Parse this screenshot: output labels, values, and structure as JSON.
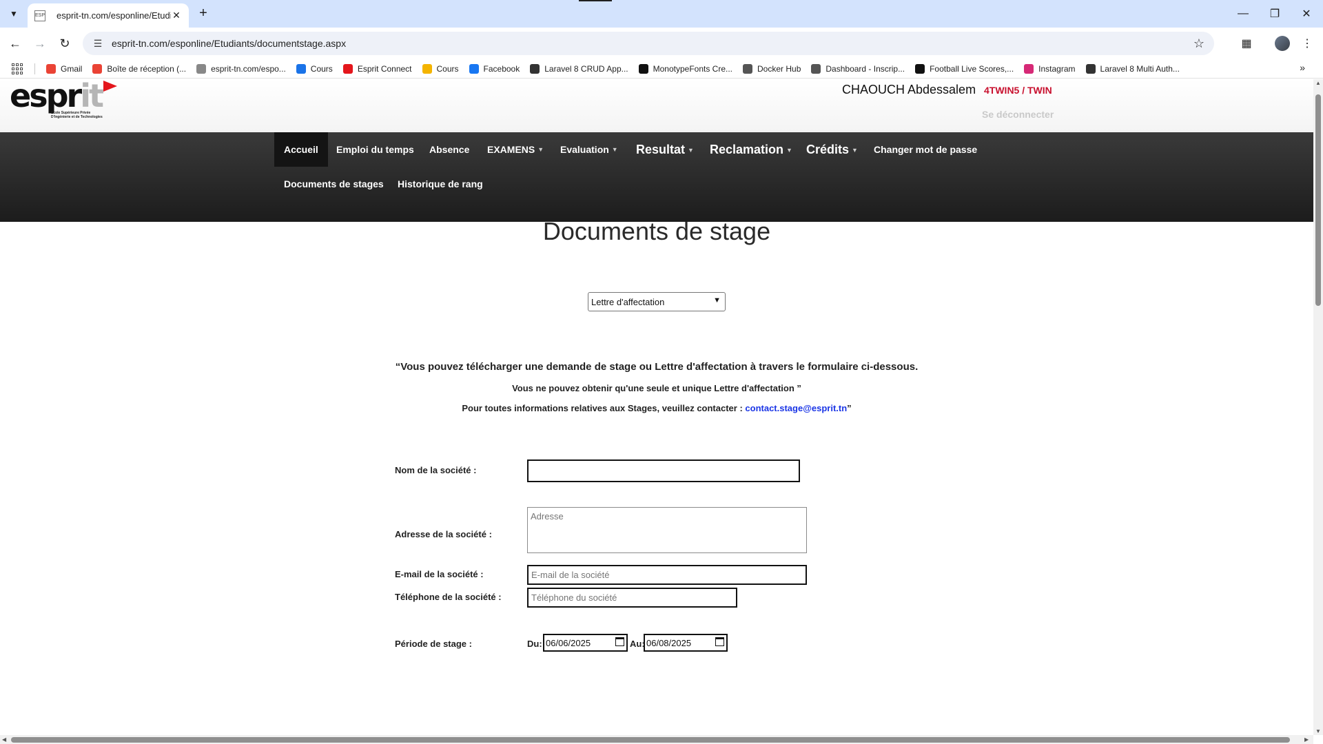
{
  "browser": {
    "tab_title": "esprit-tn.com/esponline/Etudia",
    "tab_favicon": "ESP",
    "url": "esprit-tn.com/esponline/Etudiants/documentstage.aspx",
    "bookmarks": [
      {
        "label": "Gmail",
        "icon": "gmail-icon",
        "color": "#ea4335"
      },
      {
        "label": "Boîte de réception (...",
        "icon": "gmail-icon",
        "color": "#ea4335"
      },
      {
        "label": "esprit-tn.com/espo...",
        "icon": "esprit-icon",
        "color": "#888888"
      },
      {
        "label": "Cours",
        "icon": "drive-icon",
        "color": "#1a73e8"
      },
      {
        "label": "Esprit Connect",
        "icon": "esprit-flag-icon",
        "color": "#e4161c"
      },
      {
        "label": "Cours",
        "icon": "classroom-icon",
        "color": "#f4b400"
      },
      {
        "label": "Facebook",
        "icon": "facebook-icon",
        "color": "#1877f2"
      },
      {
        "label": "Laravel 8 CRUD App...",
        "icon": "web-icon",
        "color": "#333333"
      },
      {
        "label": "MonotypeFonts Cre...",
        "icon": "monotype-icon",
        "color": "#111111"
      },
      {
        "label": "Docker Hub",
        "icon": "docker-icon",
        "color": "#555555"
      },
      {
        "label": "Dashboard - Inscrip...",
        "icon": "globe-icon",
        "color": "#555555"
      },
      {
        "label": "Football Live Scores,...",
        "icon": "football-icon",
        "color": "#111111"
      },
      {
        "label": "Instagram",
        "icon": "instagram-icon",
        "color": "#d62976"
      },
      {
        "label": "Laravel 8 Multi Auth...",
        "icon": "web-icon",
        "color": "#333333"
      }
    ]
  },
  "header": {
    "logo_text_dark": "espr",
    "logo_text_grey": "it",
    "logo_tagline_1": "Ecole Supérieure Privée",
    "logo_tagline_2": "D'Ingénierie et de Technologies",
    "user_name": "CHAOUCH Abdessalem",
    "user_class": "4TWIN5 / TWIN",
    "logout_label": "Se déconnecter"
  },
  "nav": {
    "accueil": "Accueil",
    "emploi": "Emploi du temps",
    "absence": "Absence",
    "examens": "EXAMENS",
    "evaluation": "Evaluation",
    "resultat": "Resultat",
    "reclamation": "Reclamation",
    "credits": "Crédits",
    "changer_mdp": "Changer mot de passe",
    "documents": "Documents de stages",
    "historique": "Historique de rang"
  },
  "page": {
    "title": "Documents de stage",
    "document_type_selected": "Lettre d'affectation",
    "info_main": "“Vous pouvez télécharger une demande de stage ou Lettre d'affectation à travers le formulaire ci-dessous.",
    "info_unique": "Vous ne pouvez obtenir qu'une seule et unique Lettre d'affectation ”",
    "info_contact_prefix": "Pour toutes informations relatives aux Stages, veuillez contacter :",
    "info_contact_email": "contact.stage@esprit.tn",
    "info_contact_suffix": "”"
  },
  "form": {
    "nom_label": "Nom de la société  :",
    "nom_value": "",
    "adresse_label": "Adresse de la société  :",
    "adresse_placeholder": "Adresse",
    "email_label": "E-mail de la société  :",
    "email_placeholder": "E-mail de la société",
    "tel_label": "Téléphone de la société :",
    "tel_placeholder": "Téléphone du société",
    "periode_label": "Période de stage :",
    "du_label": "Du:",
    "du_value": "06/06/2025",
    "au_label": "Au:",
    "au_value": "06/08/2025"
  },
  "colors": {
    "accent_red": "#c8102e",
    "nav_background": "#2a2a2a",
    "link_blue": "#1a35e6",
    "chrome_tabstrip": "#d3e3fd"
  }
}
